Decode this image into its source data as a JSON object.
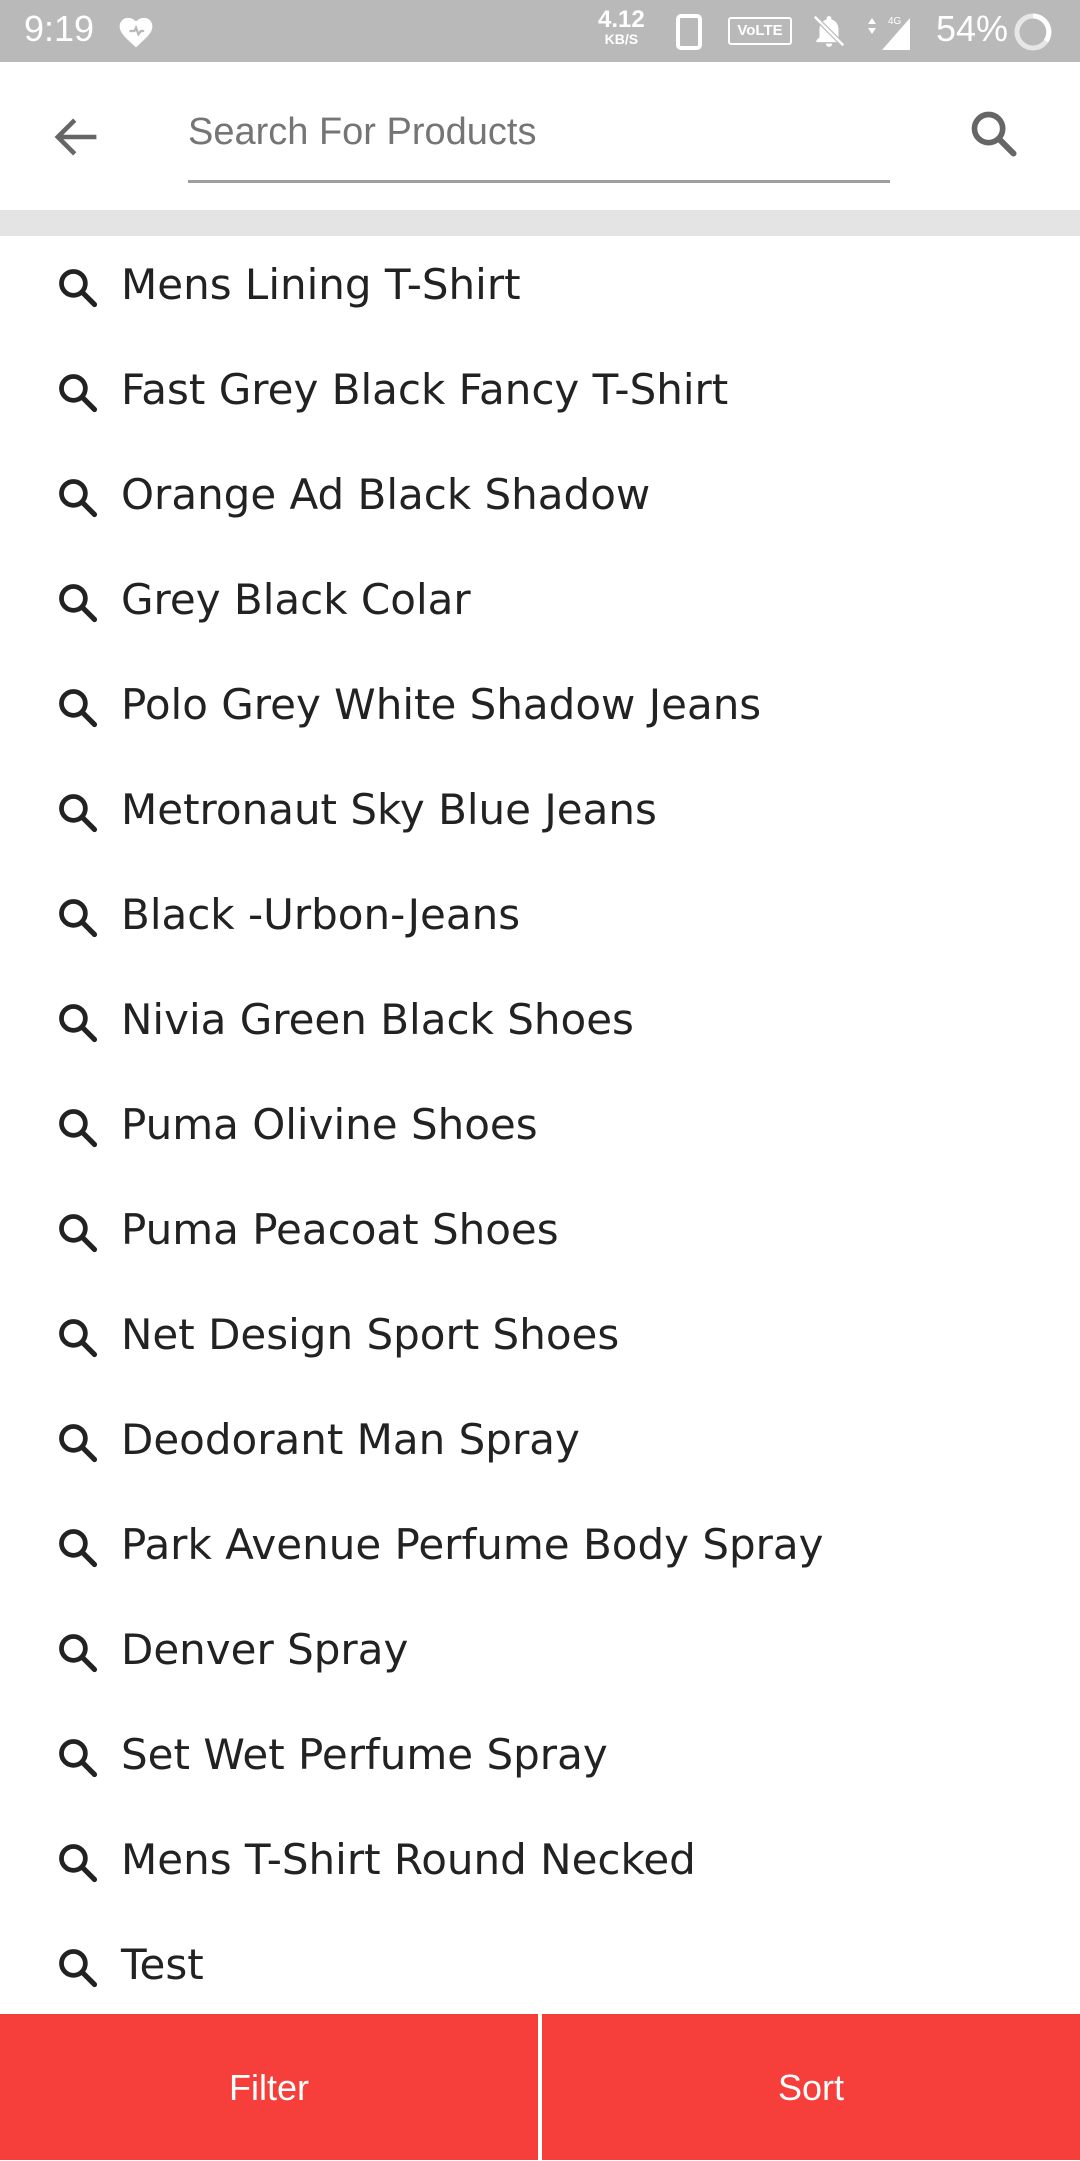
{
  "status_bar": {
    "time": "9:19",
    "net_speed_value": "4.12",
    "net_speed_unit": "KB/S",
    "volte_label": "VoLTE",
    "network_label": "4G",
    "battery": "54%",
    "icons": [
      "heart-icon",
      "phone-icon",
      "bell-off-icon",
      "signal-icon",
      "battery-icon"
    ]
  },
  "search": {
    "placeholder": "Search For Products",
    "back_icon": "arrow-left-icon",
    "search_icon": "search-icon"
  },
  "suggestions": [
    "Mens Lining T-Shirt",
    "Fast Grey Black Fancy T-Shirt",
    "Orange Ad Black Shadow",
    "Grey Black Colar",
    "Polo Grey White Shadow Jeans",
    "Metronaut Sky Blue Jeans",
    "Black -Urbon-Jeans",
    "Nivia Green Black Shoes",
    "Puma Olivine Shoes",
    "Puma Peacoat Shoes",
    "Net Design Sport Shoes",
    "Deodorant Man Spray",
    "Park Avenue Perfume Body Spray",
    "Denver Spray",
    "Set Wet Perfume Spray",
    "Mens T-Shirt Round Necked",
    "Test"
  ],
  "bottom_bar": {
    "filter_label": "Filter",
    "sort_label": "Sort"
  },
  "colors": {
    "accent": "#f63e3a",
    "status_bar": "#b9b9b9",
    "divider": "#e4e4e4"
  }
}
